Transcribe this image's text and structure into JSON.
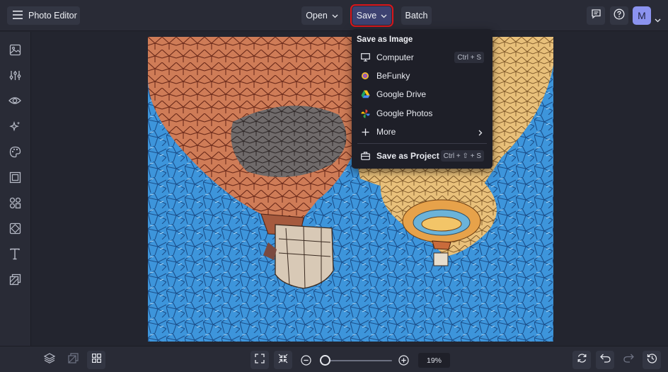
{
  "topbar": {
    "app_title": "Photo Editor",
    "open_label": "Open",
    "save_label": "Save",
    "batch_label": "Batch",
    "avatar_initial": "M"
  },
  "save_menu": {
    "header": "Save as Image",
    "items": [
      {
        "label": "Computer",
        "shortcut": "Ctrl + S"
      },
      {
        "label": "BeFunky",
        "shortcut": ""
      },
      {
        "label": "Google Drive",
        "shortcut": ""
      },
      {
        "label": "Google Photos",
        "shortcut": ""
      },
      {
        "label": "More",
        "shortcut": ""
      }
    ],
    "project_label": "Save as Project",
    "project_shortcut": "Ctrl + ⇧ + S"
  },
  "bottombar": {
    "zoom_value": "19%",
    "zoom_fraction": 0.0
  },
  "colors": {
    "accent": "#8b93ef",
    "save_highlight": "#d9161c",
    "background": "#23252f"
  }
}
